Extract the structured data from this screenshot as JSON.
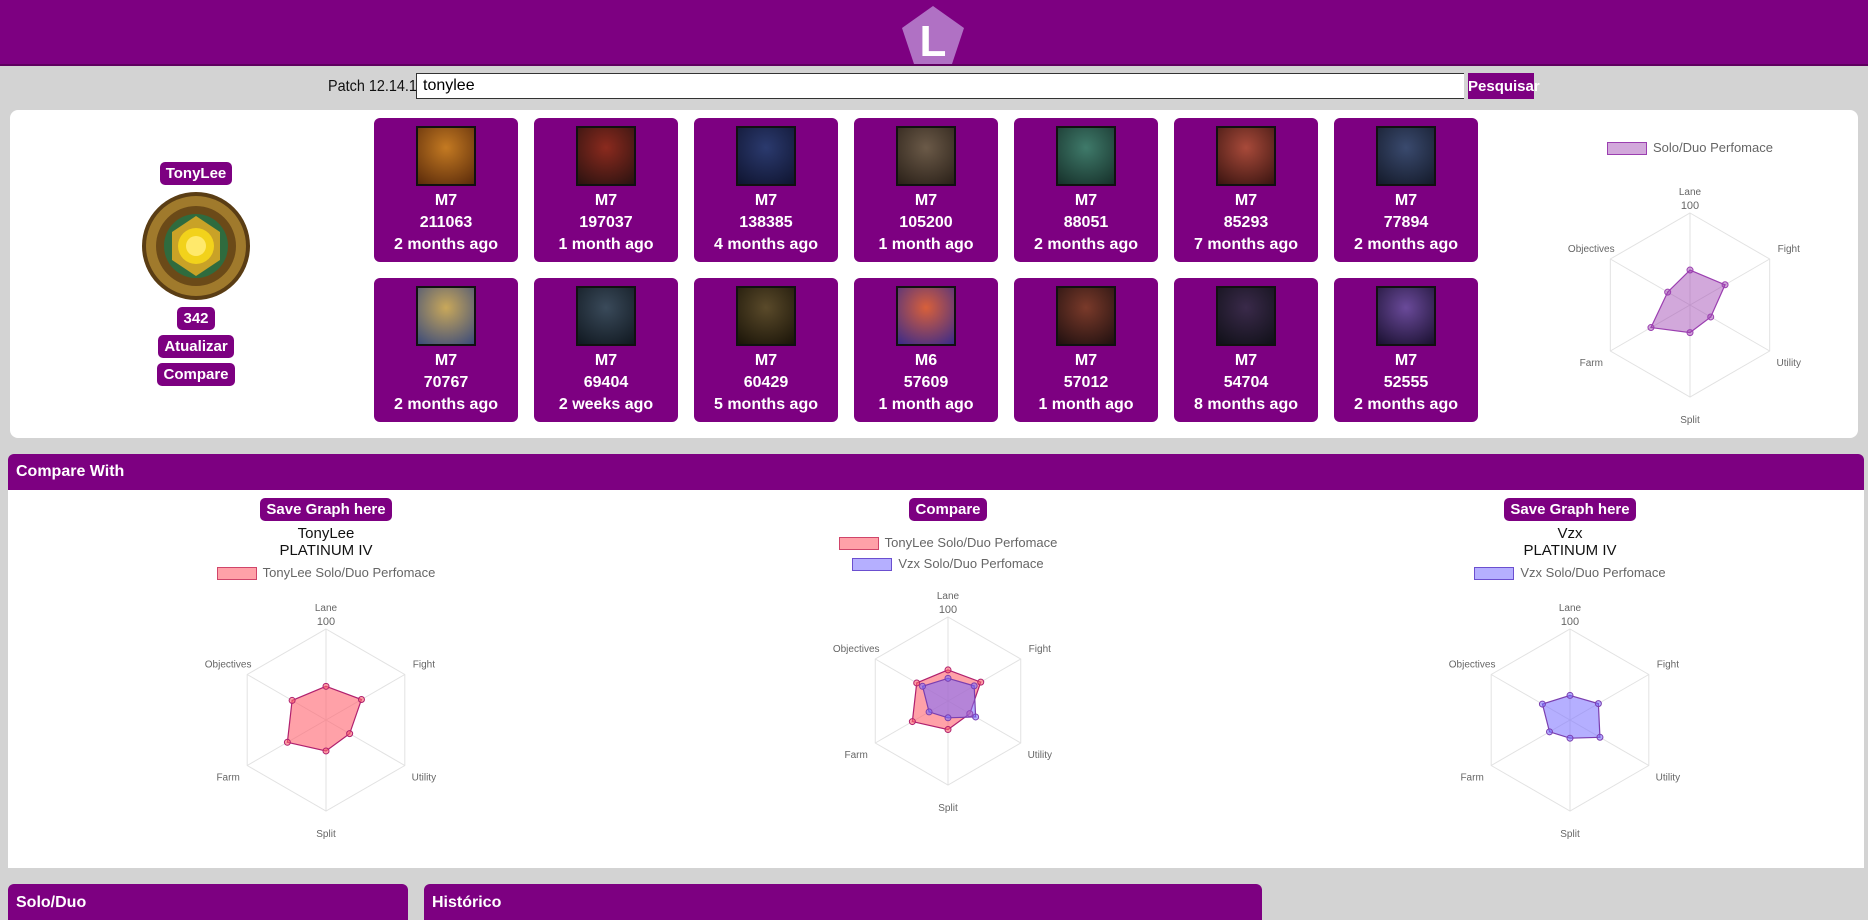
{
  "header": {
    "logo_letter": "L",
    "brand_color": "#7d0081"
  },
  "search": {
    "patch_label": "Patch 12.14.1",
    "value": "tonylee",
    "button_label": "Pesquisar"
  },
  "profile": {
    "name": "TonyLee",
    "level": "342",
    "update_label": "Atualizar",
    "compare_label": "Compare"
  },
  "champions": [
    {
      "mastery": "M7",
      "points": "211063",
      "last_played": "2 months ago"
    },
    {
      "mastery": "M7",
      "points": "197037",
      "last_played": "1 month ago"
    },
    {
      "mastery": "M7",
      "points": "138385",
      "last_played": "4 months ago"
    },
    {
      "mastery": "M7",
      "points": "105200",
      "last_played": "1 month ago"
    },
    {
      "mastery": "M7",
      "points": "88051",
      "last_played": "2 months ago"
    },
    {
      "mastery": "M7",
      "points": "85293",
      "last_played": "7 months ago"
    },
    {
      "mastery": "M7",
      "points": "77894",
      "last_played": "2 months ago"
    },
    {
      "mastery": "M7",
      "points": "70767",
      "last_played": "2 months ago"
    },
    {
      "mastery": "M7",
      "points": "69404",
      "last_played": "2 weeks ago"
    },
    {
      "mastery": "M7",
      "points": "60429",
      "last_played": "5 months ago"
    },
    {
      "mastery": "M6",
      "points": "57609",
      "last_played": "1 month ago"
    },
    {
      "mastery": "M7",
      "points": "57012",
      "last_played": "1 month ago"
    },
    {
      "mastery": "M7",
      "points": "54704",
      "last_played": "8 months ago"
    },
    {
      "mastery": "M7",
      "points": "52555",
      "last_played": "2 months ago"
    }
  ],
  "compare": {
    "header": "Compare With",
    "left": {
      "save_label": "Save Graph here",
      "name": "TonyLee",
      "rank": "PLATINUM IV"
    },
    "center": {
      "compare_label": "Compare"
    },
    "right": {
      "save_label": "Save Graph here",
      "name": "Vzx",
      "rank": "PLATINUM IV"
    }
  },
  "bottom_tabs": {
    "solo_duo": "Solo/Duo",
    "historico": "Histórico"
  },
  "chart_data": [
    {
      "type": "radar",
      "categories": [
        "Lane",
        "Fight",
        "Utility",
        "Split",
        "Farm",
        "Objectives"
      ],
      "tick_label": "100",
      "rmax": 100,
      "series": [
        {
          "name": "Solo/Duo Perfomace",
          "values": [
            38,
            44,
            26,
            30,
            49,
            28
          ],
          "color": "#9b3fb0",
          "fill": "rgba(155,63,176,0.45)"
        }
      ]
    },
    {
      "type": "radar",
      "categories": [
        "Lane",
        "Fight",
        "Utility",
        "Split",
        "Farm",
        "Objectives"
      ],
      "tick_label": "100",
      "rmax": 100,
      "series": [
        {
          "name": "TonyLee Solo/Duo Perfomace",
          "values": [
            37,
            45,
            30,
            34,
            49,
            43
          ],
          "color": "#b0206e",
          "fill": "rgba(255,99,110,0.6)"
        }
      ]
    },
    {
      "type": "radar",
      "categories": [
        "Lane",
        "Fight",
        "Utility",
        "Split",
        "Farm",
        "Objectives"
      ],
      "tick_label": "100",
      "rmax": 100,
      "series": [
        {
          "name": "TonyLee Solo/Duo Perfomace",
          "values": [
            37,
            45,
            30,
            34,
            49,
            43
          ],
          "color": "#b0206e",
          "fill": "rgba(255,99,110,0.6)"
        },
        {
          "name": "Vzx Solo/Duo Perfomace",
          "values": [
            27,
            36,
            38,
            20,
            26,
            35
          ],
          "color": "#7b3fb0",
          "fill": "rgba(120,110,255,0.55)"
        }
      ]
    },
    {
      "type": "radar",
      "categories": [
        "Lane",
        "Fight",
        "Utility",
        "Split",
        "Farm",
        "Objectives"
      ],
      "tick_label": "100",
      "rmax": 100,
      "series": [
        {
          "name": "Vzx Solo/Duo Perfomace",
          "values": [
            27,
            36,
            38,
            20,
            26,
            35
          ],
          "color": "#7b3fb0",
          "fill": "rgba(120,110,255,0.55)"
        }
      ]
    }
  ]
}
